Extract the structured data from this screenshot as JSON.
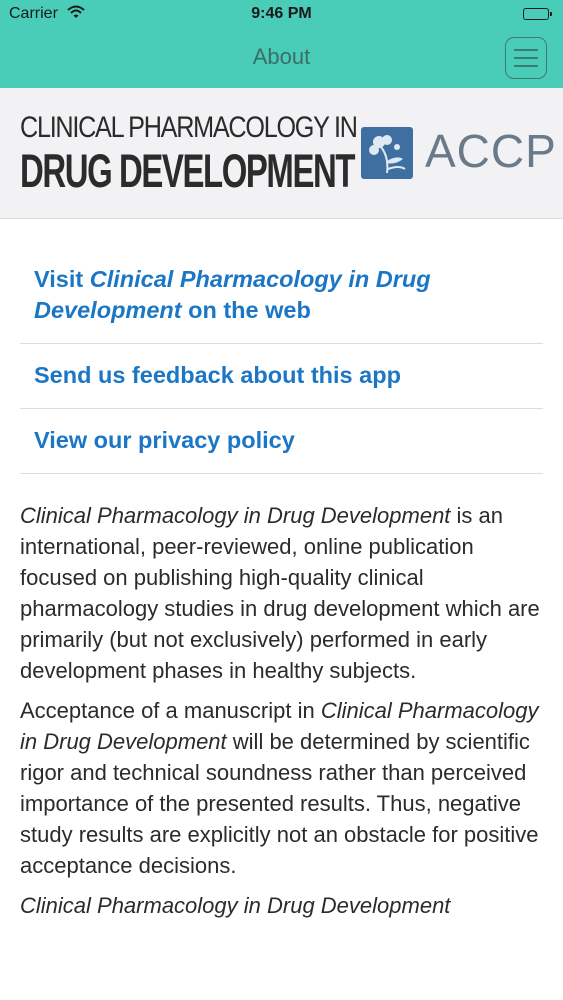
{
  "status_bar": {
    "carrier": "Carrier",
    "time": "9:46 PM"
  },
  "nav": {
    "title": "About"
  },
  "header": {
    "logo_line1": "CLINICAL PHARMACOLOGY IN",
    "logo_line2": "DRUG DEVELOPMENT",
    "accp": "ACCP"
  },
  "links": {
    "visit_prefix": "Visit ",
    "visit_journal": "Clinical Pharmacology in Drug Development",
    "visit_suffix": " on the web",
    "feedback": "Send us feedback about this app",
    "privacy": "View our privacy policy"
  },
  "about": {
    "p1_journal": "Clinical Pharmacology in Drug Development",
    "p1_text": " is an international, peer-reviewed, online publication focused on publishing high-quality clinical pharmacology studies in drug development which are primarily (but not exclusively) performed in early development phases in healthy subjects.",
    "p2_prefix": "Acceptance of a manuscript in ",
    "p2_journal": "Clinical Pharmacology in Drug Development",
    "p2_text": " will be determined by scientific rigor and technical soundness rather than perceived importance of the presented results. Thus, negative study results are explicitly not an obstacle for positive acceptance decisions.",
    "p3_journal": "Clinical Pharmacology in Drug Development"
  },
  "colors": {
    "accent": "#49cdb8",
    "link": "#1b77c5",
    "badge": "#3f6fa0"
  },
  "icons": [
    "wifi-icon",
    "battery-icon",
    "menu-icon",
    "accp-flower-icon"
  ]
}
